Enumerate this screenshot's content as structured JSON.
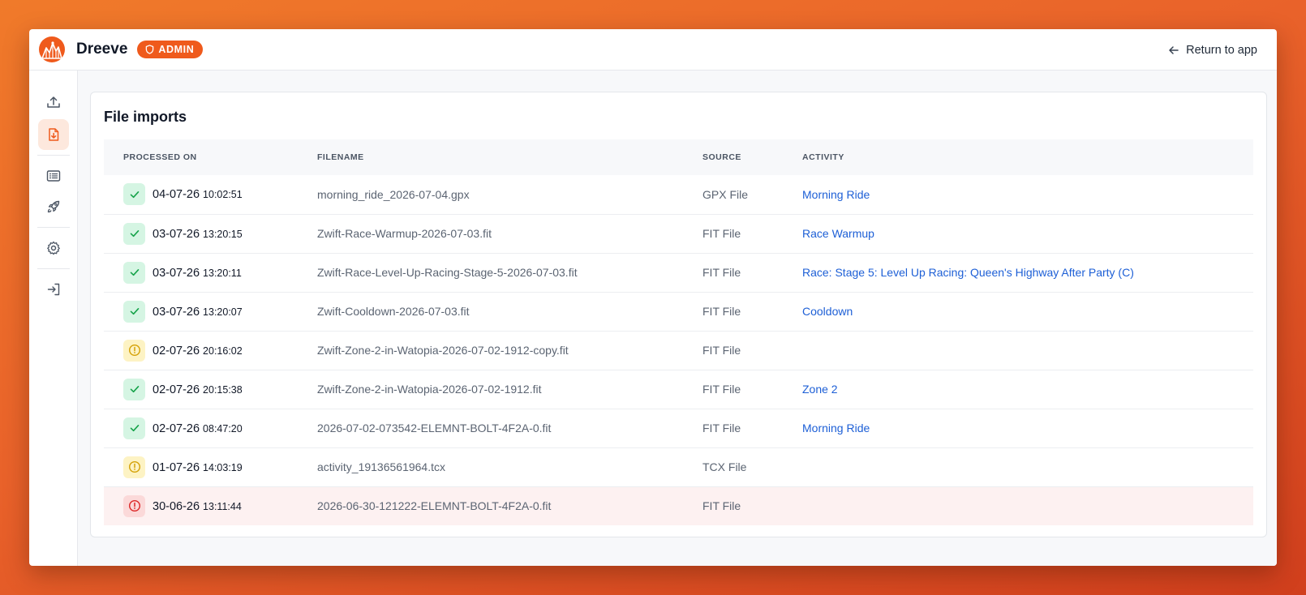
{
  "app": {
    "name": "Dreeve",
    "badge": "ADMIN"
  },
  "header": {
    "return_label": "Return to app"
  },
  "sidebar": {
    "items": [
      {
        "id": "upload",
        "icon": "upload-icon",
        "active": false
      },
      {
        "id": "file-imports",
        "icon": "file-import-icon",
        "active": true
      },
      {
        "id": "activities",
        "icon": "list-icon",
        "active": false
      },
      {
        "id": "launch",
        "icon": "rocket-icon",
        "active": false
      },
      {
        "id": "settings",
        "icon": "gear-icon",
        "active": false
      },
      {
        "id": "sign-in",
        "icon": "login-icon",
        "active": false
      }
    ]
  },
  "page": {
    "title": "File imports"
  },
  "table": {
    "headers": {
      "processed_on": "PROCESSED ON",
      "filename": "FILENAME",
      "source": "SOURCE",
      "activity": "ACTIVITY"
    },
    "rows": [
      {
        "status": "success",
        "date": "04-07-26",
        "time": "10:02:51",
        "filename": "morning_ride_2026-07-04.gpx",
        "source": "GPX File",
        "activity": "Morning Ride"
      },
      {
        "status": "success",
        "date": "03-07-26",
        "time": "13:20:15",
        "filename": "Zwift-Race-Warmup-2026-07-03.fit",
        "source": "FIT File",
        "activity": "Race Warmup"
      },
      {
        "status": "success",
        "date": "03-07-26",
        "time": "13:20:11",
        "filename": "Zwift-Race-Level-Up-Racing-Stage-5-2026-07-03.fit",
        "source": "FIT File",
        "activity": "Race: Stage 5: Level Up Racing: Queen's Highway After Party (C)"
      },
      {
        "status": "success",
        "date": "03-07-26",
        "time": "13:20:07",
        "filename": "Zwift-Cooldown-2026-07-03.fit",
        "source": "FIT File",
        "activity": "Cooldown"
      },
      {
        "status": "warning",
        "date": "02-07-26",
        "time": "20:16:02",
        "filename": "Zwift-Zone-2-in-Watopia-2026-07-02-1912-copy.fit",
        "source": "FIT File",
        "activity": ""
      },
      {
        "status": "success",
        "date": "02-07-26",
        "time": "20:15:38",
        "filename": "Zwift-Zone-2-in-Watopia-2026-07-02-1912.fit",
        "source": "FIT File",
        "activity": "Zone 2"
      },
      {
        "status": "success",
        "date": "02-07-26",
        "time": "08:47:20",
        "filename": "2026-07-02-073542-ELEMNT-BOLT-4F2A-0.fit",
        "source": "FIT File",
        "activity": "Morning Ride"
      },
      {
        "status": "warning",
        "date": "01-07-26",
        "time": "14:03:19",
        "filename": "activity_19136561964.tcx",
        "source": "TCX File",
        "activity": ""
      },
      {
        "status": "error",
        "date": "30-06-26",
        "time": "13:11:44",
        "filename": "2026-06-30-121222-ELEMNT-BOLT-4F2A-0.fit",
        "source": "FIT File",
        "activity": ""
      }
    ]
  },
  "colors": {
    "brand": "#ef5a1c",
    "link": "#1d5fd6",
    "success": "#16a34a",
    "warning": "#d4a106",
    "error": "#dc2626"
  }
}
